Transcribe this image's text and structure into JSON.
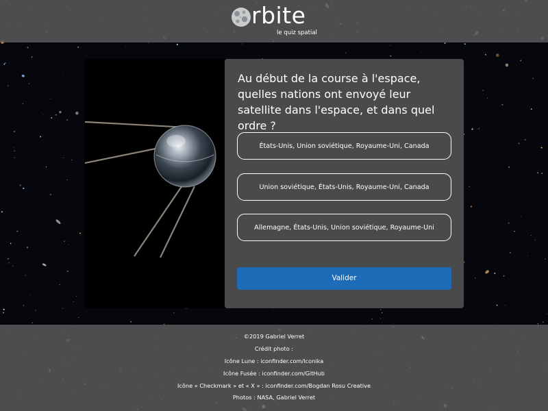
{
  "header": {
    "logo_word": "rbite",
    "logo_tagline": "le quiz spatial"
  },
  "quiz": {
    "question": "Au début de la course à l'espace, quelles nations ont envoyé leur satellite dans l'espace, et dans quel ordre ?",
    "answers": [
      "États-Unis, Union soviétique, Royaume-Uni, Canada",
      "Union soviétique, États-Unis, Royaume-Uni, Canada",
      "Allemagne, États-Unis, Union soviétique, Royaume-Uni"
    ],
    "validate_label": "Valider",
    "image_icon": "sputnik-satellite"
  },
  "footer": {
    "lines": [
      "©2019 Gabriel Verret",
      "Crédit photo :",
      "Icône Lune : iconfinder.com/Iconika",
      "Icône Fusée : iconfinder.com/GitHub",
      "Icône « Checkmark » et « X » : iconfinder.com/Bogdan Rosu Creative",
      "Photos : NASA, Gabriel Verret"
    ]
  },
  "colors": {
    "header_footer_bg": "#58585a",
    "panel_bg": "#4a4a4a",
    "primary_button": "#1e6bb8",
    "text": "#ffffff",
    "page_bg": "#06070d"
  }
}
